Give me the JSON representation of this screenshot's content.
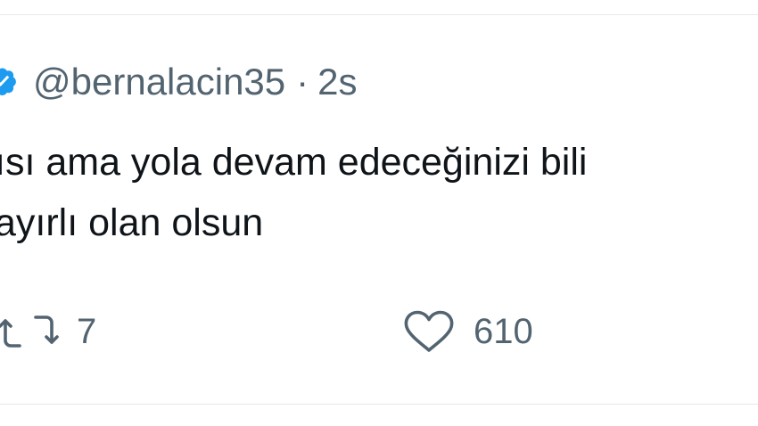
{
  "tweet": {
    "handle": "@bernalacin35",
    "separator": "·",
    "time_ago": "2s",
    "text_lines": [
      "ısı ama yola devam edeceğinizi bili",
      "ayırlı olan olsun"
    ],
    "retweet_count": "7",
    "like_count": "610"
  },
  "icons": {
    "verified": "verified-badge-icon",
    "retweet": "retweet-icon",
    "like": "heart-icon"
  },
  "colors": {
    "verified_blue": "#1d9bf0",
    "muted_text": "#536471",
    "body_text": "#0f1419"
  }
}
